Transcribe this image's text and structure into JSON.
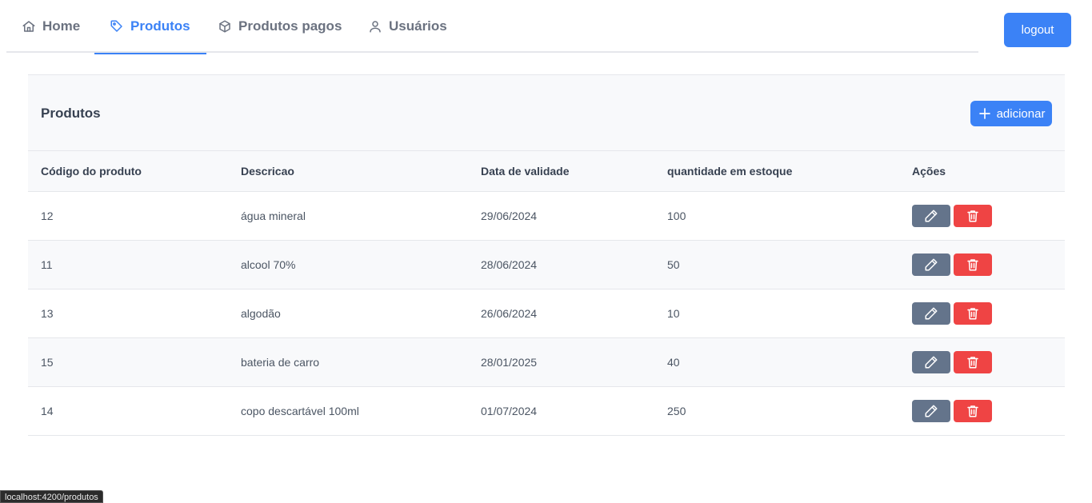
{
  "nav": {
    "tabs": [
      {
        "label": "Home",
        "icon": "home-icon"
      },
      {
        "label": "Produtos",
        "icon": "tag-icon",
        "active": true
      },
      {
        "label": "Produtos pagos",
        "icon": "box-icon"
      },
      {
        "label": "Usuários",
        "icon": "user-icon"
      }
    ],
    "logout_label": "logout"
  },
  "card": {
    "title": "Produtos",
    "add_label": "adicionar"
  },
  "table": {
    "columns": [
      "Código do produto",
      "Descricao",
      "Data de validade",
      "quantidade em estoque",
      "Ações"
    ],
    "rows": [
      {
        "codigo": "12",
        "descricao": "água mineral",
        "validade": "29/06/2024",
        "quantidade": "100"
      },
      {
        "codigo": "11",
        "descricao": "alcool 70%",
        "validade": "28/06/2024",
        "quantidade": "50"
      },
      {
        "codigo": "13",
        "descricao": "algodão",
        "validade": "26/06/2024",
        "quantidade": "10"
      },
      {
        "codigo": "15",
        "descricao": "bateria de carro",
        "validade": "28/01/2025",
        "quantidade": "40"
      },
      {
        "codigo": "14",
        "descricao": "copo descartável 100ml",
        "validade": "01/07/2024",
        "quantidade": "250"
      }
    ]
  },
  "status_bar": {
    "url": "localhost:4200/produtos"
  },
  "colors": {
    "primary": "#3b82f6",
    "edit": "#64748b",
    "delete": "#ef4444"
  }
}
